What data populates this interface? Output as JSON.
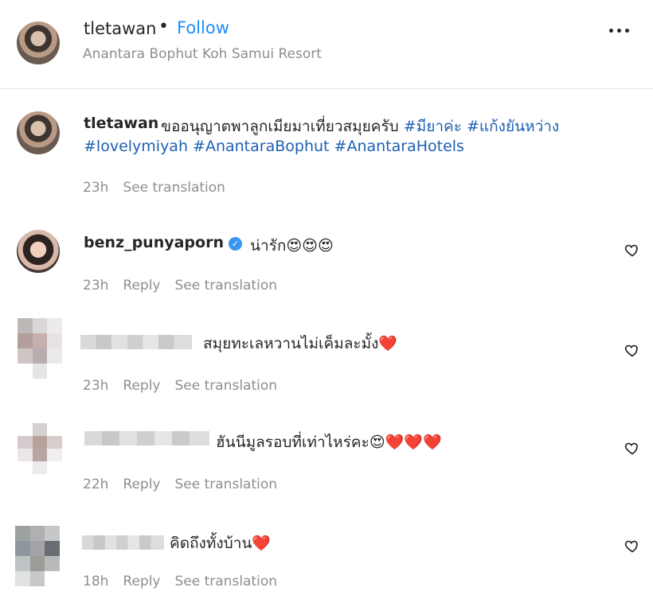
{
  "header": {
    "username": "tletawan",
    "dot": "•",
    "follow": "Follow",
    "location": "Anantara Bophut Koh Samui Resort"
  },
  "caption": {
    "username": "tletawan",
    "text": "ขออนุญาตพาลูกเมียมาเที่ยวสมุยครับ",
    "tags_line1": [
      "#มียาค่ะ",
      "#แก้งยันหว่าง"
    ],
    "tags_line2": "#lovelymiyah #AnantaraBophut #AnantaraHotels",
    "time": "23h",
    "see_translation": "See translation"
  },
  "comments": [
    {
      "username": "benz_punyaporn",
      "verified": true,
      "text": "น่ารัก😍😍😍",
      "time": "23h",
      "reply": "Reply",
      "see_translation": "See translation"
    },
    {
      "username": "",
      "text": "สมุยทะเลหวานไม่เค็มละมั้ง❤️",
      "time": "23h",
      "reply": "Reply",
      "see_translation": "See translation"
    },
    {
      "username": "",
      "text": "ฮันนีมูลรอบที่เท่าไหร่คะ😍❤️❤️❤️",
      "time": "22h",
      "reply": "Reply",
      "see_translation": "See translation"
    },
    {
      "username": "",
      "text": "คิดถึงทั้งบ้าน❤️",
      "time": "18h",
      "reply": "Reply",
      "see_translation": "See translation"
    }
  ],
  "icons": {
    "more": "more-icon",
    "verified": "verified-badge-icon",
    "heart": "heart-outline-icon"
  }
}
